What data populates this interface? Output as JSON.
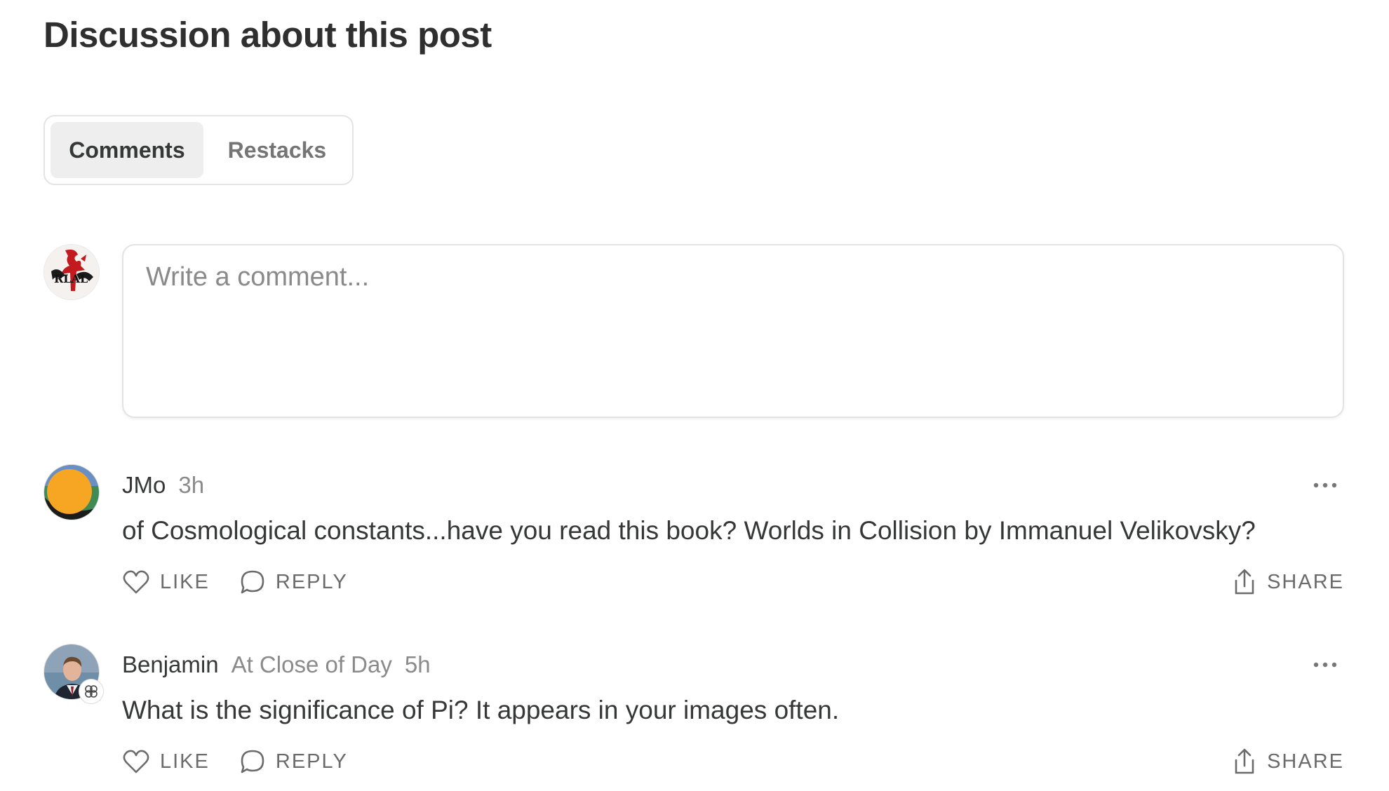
{
  "section": {
    "title": "Discussion about this post"
  },
  "tabs": [
    {
      "label": "Comments",
      "active": true
    },
    {
      "label": "Restacks",
      "active": false
    }
  ],
  "composer": {
    "placeholder": "Write a comment...",
    "avatar_icon": "user-avatar-red-ink-logo"
  },
  "comments": [
    {
      "author": "JMo",
      "publication": "",
      "time": "3h",
      "text": "of Cosmological constants...have you read this book? Worlds in Collision by Immanuel Velikovsky?",
      "avatar": "yellow-circle-avatar",
      "actions": {
        "like": "LIKE",
        "reply": "REPLY",
        "share": "SHARE"
      }
    },
    {
      "author": "Benjamin",
      "publication": "At Close of Day",
      "time": "5h",
      "text": "What is the significance of Pi? It appears in your images often.",
      "avatar": "person-photo-avatar",
      "actions": {
        "like": "LIKE",
        "reply": "REPLY",
        "share": "SHARE"
      }
    }
  ],
  "colors": {
    "text": "#363737",
    "muted": "#8a8a8a",
    "action": "#6b6b6b",
    "border": "#e3e3e3",
    "tab_active_bg": "#eeeeee"
  }
}
